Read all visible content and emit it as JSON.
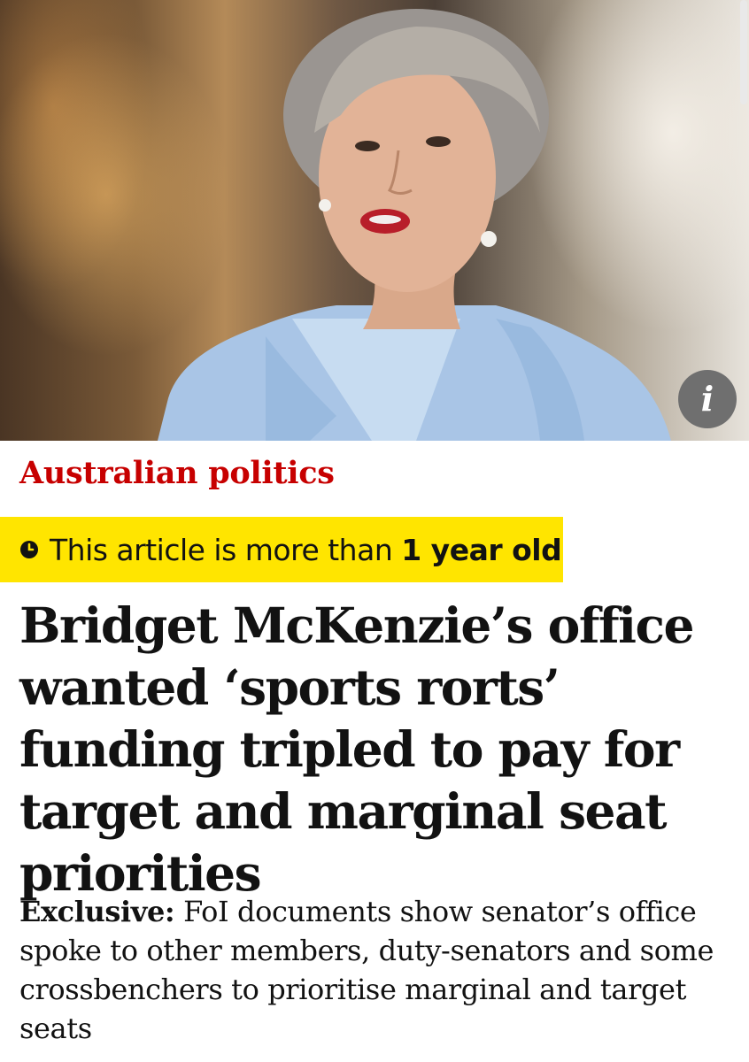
{
  "hero": {
    "image_icon": "portrait-photo",
    "info_button_label": "i"
  },
  "section": {
    "label": "Australian politics",
    "color": "#c70000"
  },
  "age_badge": {
    "icon": "clock-icon",
    "text_prefix": "This article is more than ",
    "text_bold": "1 year old",
    "background": "#ffe500"
  },
  "headline": "Bridget McKenzie’s office wanted ‘sports rorts’ funding tripled to pay for target and marginal seat priorities",
  "standfirst": {
    "kicker": "Exclusive:",
    "text": " FoI documents show senator’s office spoke to other members, duty-senators and some crossbenchers to prioritise marginal and target seats"
  }
}
